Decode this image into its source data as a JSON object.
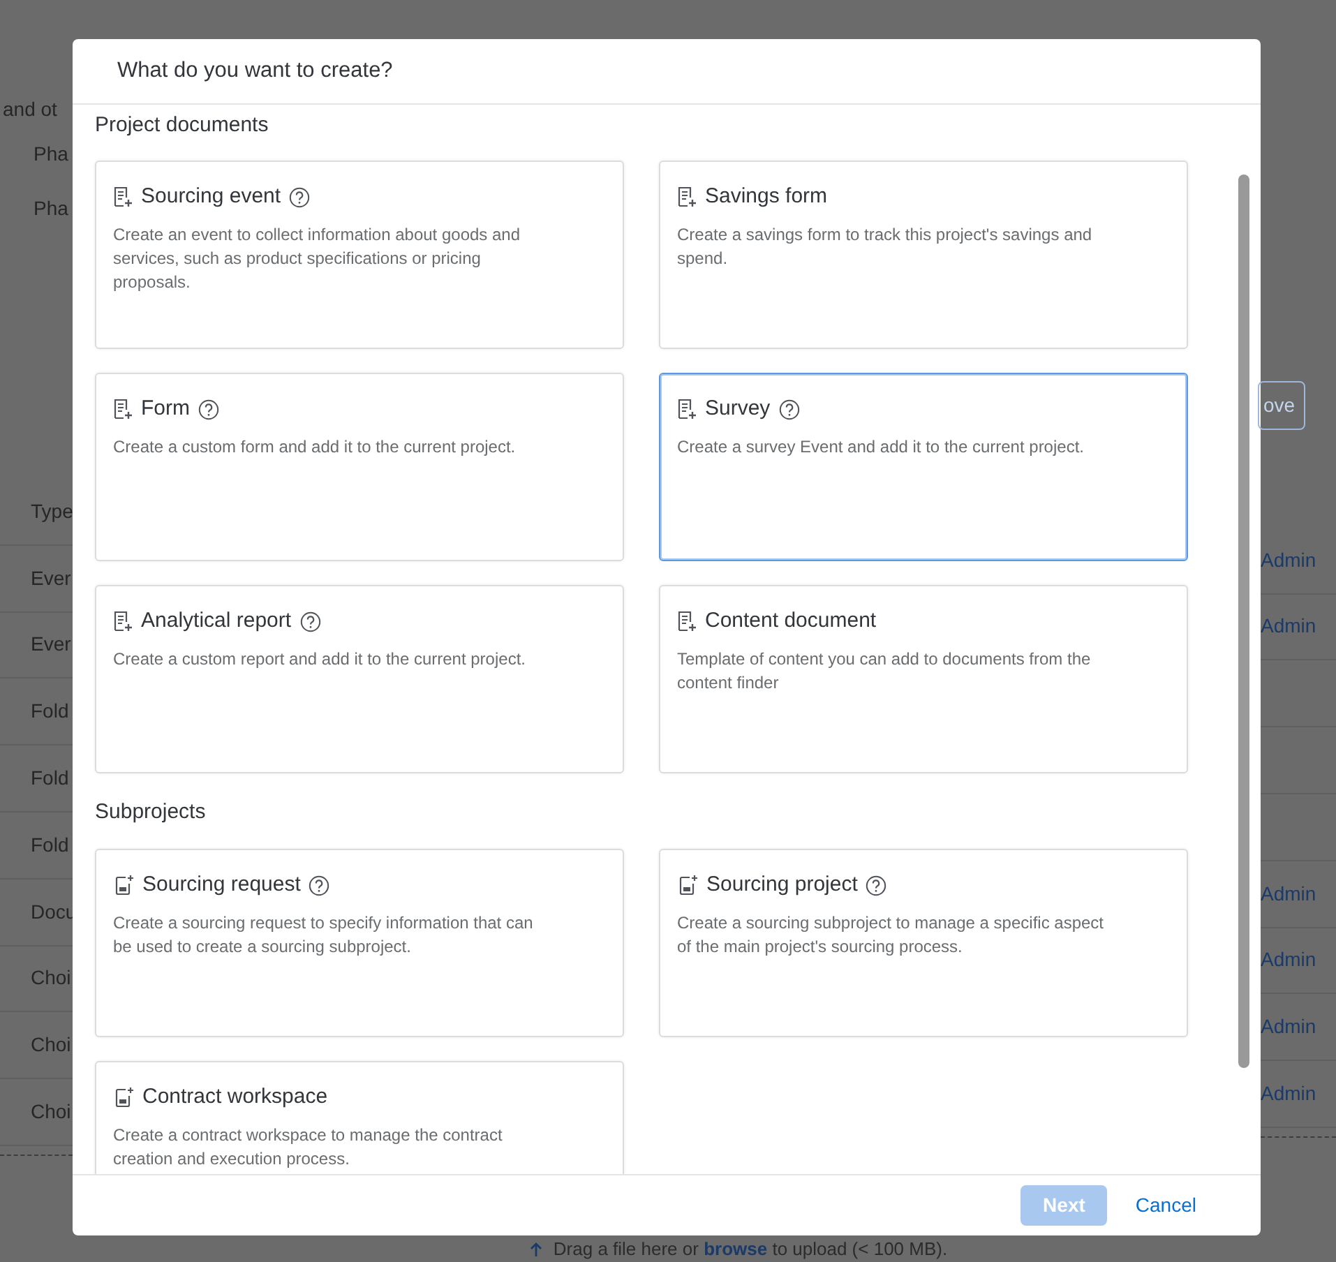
{
  "background": {
    "header_line": "and ot",
    "phases": [
      "Pha",
      "Pha"
    ],
    "action_button": "ove",
    "table": {
      "columns": [
        "Type"
      ],
      "rows": [
        {
          "type": "Ever",
          "owner": "Admin"
        },
        {
          "type": "Ever",
          "owner": "Admin"
        },
        {
          "type": "Fold"
        },
        {
          "type": "Fold"
        },
        {
          "type": "Fold"
        },
        {
          "type": "Docu",
          "owner": "Admin"
        },
        {
          "type": "Choi",
          "owner": "Admin"
        },
        {
          "type": "Choi",
          "owner": "Admin"
        },
        {
          "type": "Choi",
          "owner": "Admin"
        }
      ]
    },
    "upload_hint": "Drag a file here or **browse** to upload (< 100 MB)."
  },
  "dialog": {
    "title": "What do you want to create?",
    "sections": [
      {
        "heading": "Project documents",
        "options": [
          {
            "kind": "document",
            "title": "Sourcing event",
            "help": true,
            "selected": false,
            "description": "Create an event to collect information about goods and services, such as product specifications or pricing proposals."
          },
          {
            "kind": "document",
            "title": "Savings form",
            "help": false,
            "selected": false,
            "description": "Create a savings form to track this project's savings and spend."
          },
          {
            "kind": "document",
            "title": "Form",
            "help": true,
            "selected": false,
            "description": "Create a custom form and add it to the current project."
          },
          {
            "kind": "document",
            "title": "Survey",
            "help": true,
            "selected": true,
            "description": "Create a survey Event and add it to the current project."
          },
          {
            "kind": "document",
            "title": "Analytical report",
            "help": true,
            "selected": false,
            "description": "Create a custom report and add it to the current project."
          },
          {
            "kind": "document",
            "title": "Content document",
            "help": false,
            "selected": false,
            "description": "Template of content you can add to documents from the content finder"
          }
        ]
      },
      {
        "heading": "Subprojects",
        "options": [
          {
            "kind": "workspace",
            "title": "Sourcing request",
            "help": true,
            "selected": false,
            "description": "Create a sourcing request to specify information that can be used to create a sourcing subproject."
          },
          {
            "kind": "workspace",
            "title": "Sourcing project",
            "help": true,
            "selected": false,
            "description": "Create a sourcing subproject to manage a specific aspect of the main project's sourcing process."
          },
          {
            "kind": "workspace",
            "title": "Contract workspace",
            "help": false,
            "selected": false,
            "description": "Create a contract workspace to manage the contract creation and execution process."
          }
        ]
      }
    ],
    "buttons": [
      {
        "kind": "primary",
        "label": "Next",
        "disabled": true
      },
      {
        "kind": "link",
        "label": "Cancel",
        "disabled": false
      }
    ]
  }
}
